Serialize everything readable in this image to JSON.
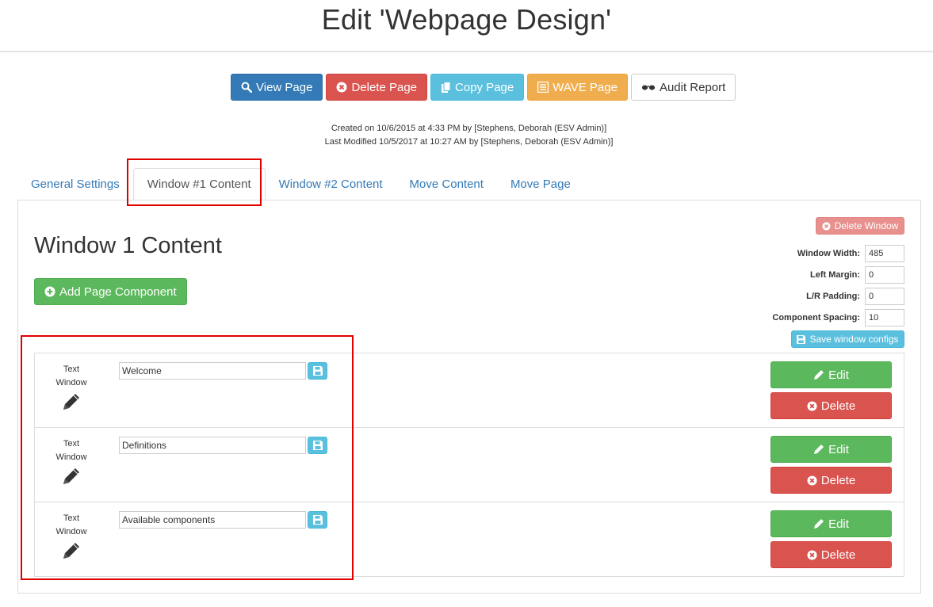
{
  "page_title": "Edit 'Webpage Design'",
  "toolbar": {
    "view_page": "View Page",
    "delete_page": "Delete Page",
    "copy_page": "Copy Page",
    "wave_page": "WAVE Page",
    "audit_report": "Audit Report"
  },
  "meta": {
    "created": "Created on 10/6/2015 at 4:33 PM by [Stephens, Deborah (ESV Admin)]",
    "modified": "Last Modified 10/5/2017 at 10:27 AM by [Stephens, Deborah (ESV Admin)]"
  },
  "tabs": [
    {
      "label": "General Settings",
      "active": false
    },
    {
      "label": "Window #1 Content",
      "active": true
    },
    {
      "label": "Window #2 Content",
      "active": false
    },
    {
      "label": "Move Content",
      "active": false
    },
    {
      "label": "Move Page",
      "active": false
    }
  ],
  "window": {
    "title": "Window 1 Content",
    "add_component": "Add Page Component",
    "delete_window": "Delete Window",
    "config": {
      "width_label": "Window Width:",
      "width_value": "485",
      "left_margin_label": "Left Margin:",
      "left_margin_value": "0",
      "padding_label": "L/R Padding:",
      "padding_value": "0",
      "spacing_label": "Component Spacing:",
      "spacing_value": "10"
    },
    "save_configs": "Save window configs"
  },
  "components": [
    {
      "type_line1": "Text",
      "type_line2": "Window",
      "name": "Welcome",
      "edit": "Edit",
      "delete": "Delete"
    },
    {
      "type_line1": "Text",
      "type_line2": "Window",
      "name": "Definitions",
      "edit": "Edit",
      "delete": "Delete"
    },
    {
      "type_line1": "Text",
      "type_line2": "Window",
      "name": "Available components",
      "edit": "Edit",
      "delete": "Delete"
    }
  ],
  "colors": {
    "primary": "#337ab7",
    "danger": "#d9534f",
    "info": "#5bc0de",
    "warning": "#f0ad4e",
    "success": "#5cb85c",
    "highlight": "#e00000"
  }
}
